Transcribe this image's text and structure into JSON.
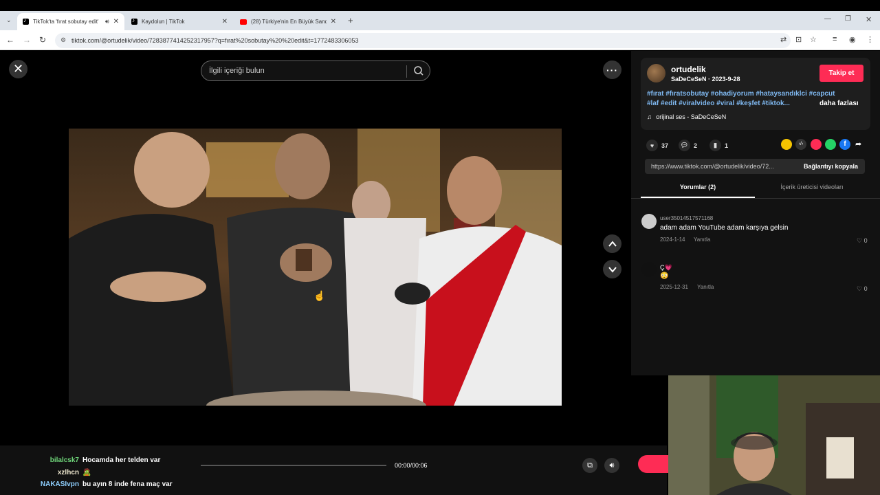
{
  "browser": {
    "tabs": [
      {
        "title": "TikTok'ta 'fırat sobutay edit'",
        "active": true,
        "favicon": "tiktok"
      },
      {
        "title": "Kaydolun | TikTok",
        "active": false,
        "favicon": "tiktok"
      },
      {
        "title": "(28) Türkiye'nin En Büyük Sandı",
        "active": false,
        "favicon": "youtube"
      }
    ],
    "url": "tiktok.com/@ortudelik/video/7283877414252317957?q=fırat%20sobutay%20%20edit&t=1772483306053"
  },
  "search": {
    "placeholder": "İlgili içeriği bulun"
  },
  "player": {
    "time": "00:00/00:06",
    "progress_fraction": 0.0
  },
  "chat": [
    {
      "user": "bilalcsk7",
      "message": "Hocamda her telden var",
      "color": "#6fd67a"
    },
    {
      "user": "xzlhcn",
      "message": "🧟",
      "color": "#f0e9d0"
    },
    {
      "user": "NAKASIvpn",
      "message": "bu ayın 8 inde fena maç var",
      "color": "#8fd0ff"
    }
  ],
  "author": {
    "username": "ortudelik",
    "nickname": "SaDeCeSeN",
    "date": "2023-9-28",
    "follow_label": "Takip et"
  },
  "description": {
    "line1": "#fırat #fıratsobutay #ohadiyorum #hataysandıklci #capcut",
    "line2": "#laf #edit #viralvideo #viral #keşfet #tiktok...",
    "more": "daha fazlası",
    "sound": "orijinal ses - SaDeCeSeN"
  },
  "stats": {
    "likes": "37",
    "comments": "2",
    "saves": "1"
  },
  "link": {
    "url": "https://www.tiktok.com/@ortudelik/video/72...",
    "copy_label": "Bağlantıyı kopyala"
  },
  "panel_tabs": {
    "comments": "Yorumlar (2)",
    "creator_videos": "İçerik üreticisi videoları"
  },
  "comments": [
    {
      "user": "user35014517571168",
      "text": "adam adam YouTube adam karşıya gelsin",
      "date": "2024-1-14",
      "reply": "Yanıtla",
      "likes": "0"
    },
    {
      "user": "Ç💗",
      "text": "😳",
      "date": "2025-12-31",
      "reply": "Yanıtla",
      "likes": "0"
    }
  ]
}
